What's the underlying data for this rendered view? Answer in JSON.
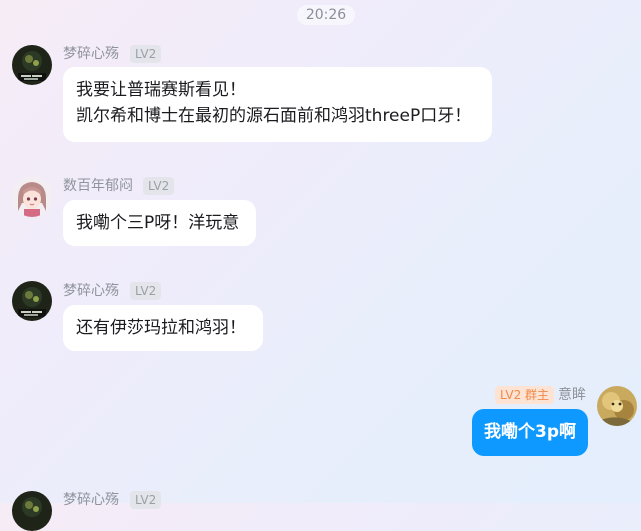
{
  "chat": {
    "timestamp": "20:26",
    "messages": [
      {
        "sender": "梦碎心殇",
        "level": "LV2",
        "avatar": "dark-anime-avatar",
        "lines": [
          "我要让普瑞赛斯看见！",
          "凯尔希和博士在最初的源石面前和鸿羽threeP口牙！"
        ]
      },
      {
        "sender": "数百年郁闷",
        "level": "LV2",
        "avatar": "pink-hair-girl-avatar",
        "lines": [
          "我嘞个三P呀！洋玩意"
        ]
      },
      {
        "sender": "梦碎心殇",
        "level": "LV2",
        "avatar": "dark-anime-avatar",
        "lines": [
          "还有伊莎玛拉和鸿羽！"
        ]
      },
      {
        "sender": "意眸",
        "level": "LV2 群主",
        "avatar": "golden-cat-avatar",
        "self": true,
        "lines": [
          "我嘞个3p啊"
        ]
      },
      {
        "sender": "梦碎心殇",
        "level": "LV2",
        "avatar": "dark-anime-avatar",
        "lines": []
      }
    ]
  }
}
